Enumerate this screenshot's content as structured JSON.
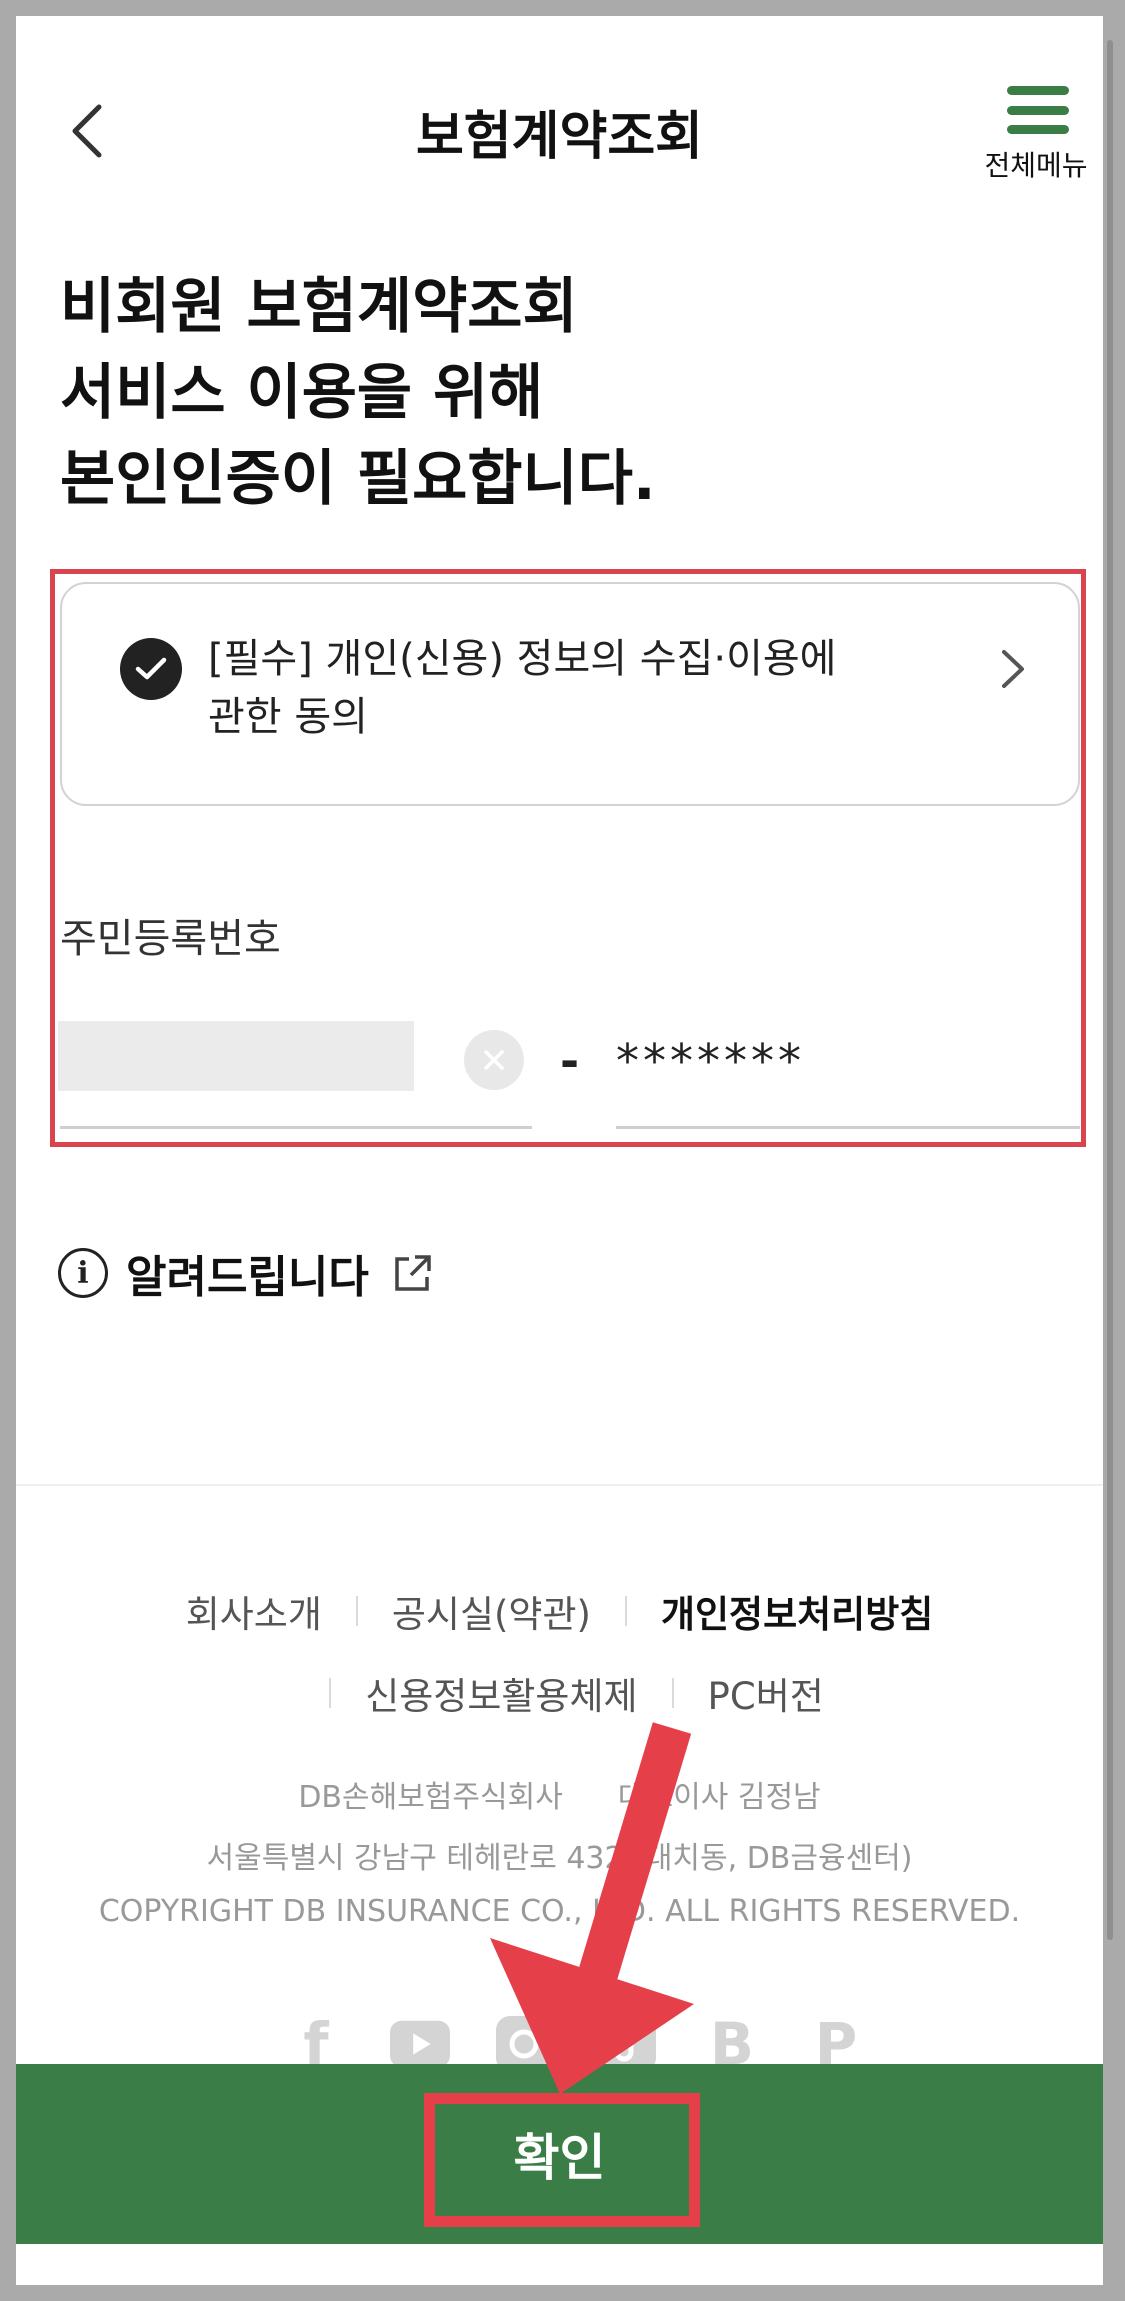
{
  "header": {
    "title": "보험계약조회",
    "menu_label": "전체메뉴"
  },
  "heading": {
    "line1": "비회원 보험계약조회",
    "line2": "서비스 이용을 위해",
    "line3": "본인인증이 필요합니다."
  },
  "consent": {
    "line1": "[필수] 개인(신용) 정보의 수집·이용에",
    "line2": "관한 동의",
    "checked": true
  },
  "rrn": {
    "label": "주민등록번호",
    "first_value": "",
    "dash": "-",
    "second_value": "*******"
  },
  "notice": {
    "label": "알려드립니다"
  },
  "footer": {
    "links_row1": [
      "회사소개",
      "공시실(약관)",
      "개인정보처리방침"
    ],
    "links_row2": [
      "신용정보활용체제",
      "PC버전"
    ],
    "company": "DB손해보험주식회사",
    "ceo": "대표이사 김정남",
    "address": "서울특별시 강남구 테헤란로 432 (대치동, DB금융센터)",
    "copyright": "COPYRIGHT DB INSURANCE CO., LTD. ALL RIGHTS RESERVED.",
    "social_icons": [
      "facebook-icon",
      "youtube-icon",
      "instagram-icon",
      "tiktok-icon",
      "blog-icon",
      "post-icon"
    ]
  },
  "confirm": {
    "label": "확인"
  },
  "colors": {
    "brand_green": "#3a7d47",
    "highlight_red": "#e5404a"
  }
}
